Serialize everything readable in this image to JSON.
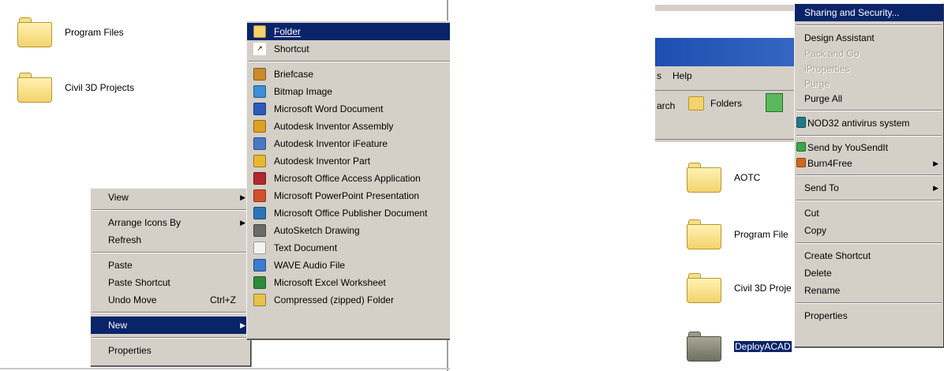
{
  "left": {
    "desktop_items": [
      "Program Files",
      "Civil 3D Projects"
    ],
    "context_menu": {
      "view": "View",
      "arrange": "Arrange Icons By",
      "refresh": "Refresh",
      "paste": "Paste",
      "paste_shortcut": "Paste Shortcut",
      "undo_move": "Undo Move",
      "undo_shortcut": "Ctrl+Z",
      "new": "New",
      "properties": "Properties"
    },
    "new_submenu": {
      "folder": "Folder",
      "shortcut": "Shortcut",
      "items": [
        {
          "label": "Briefcase",
          "icon": "briefcase-icon",
          "color": "#c98b2b"
        },
        {
          "label": "Bitmap Image",
          "icon": "bitmap-icon",
          "color": "#3a8fd6"
        },
        {
          "label": "Microsoft Word Document",
          "icon": "word-icon",
          "color": "#2b5cb8"
        },
        {
          "label": "Autodesk Inventor Assembly",
          "icon": "inventor-assembly-icon",
          "color": "#e0a020"
        },
        {
          "label": "Autodesk Inventor iFeature",
          "icon": "inventor-ifeature-icon",
          "color": "#4a78c4"
        },
        {
          "label": "Autodesk Inventor Part",
          "icon": "inventor-part-icon",
          "color": "#e8b830"
        },
        {
          "label": "Microsoft Office Access Application",
          "icon": "access-icon",
          "color": "#b3282d"
        },
        {
          "label": "Microsoft PowerPoint Presentation",
          "icon": "powerpoint-icon",
          "color": "#d2502a"
        },
        {
          "label": "Microsoft Office Publisher Document",
          "icon": "publisher-icon",
          "color": "#2c74b8"
        },
        {
          "label": "AutoSketch Drawing",
          "icon": "autosketch-icon",
          "color": "#6a6a6a"
        },
        {
          "label": "Text Document",
          "icon": "text-document-icon",
          "color": "#f4f4f4"
        },
        {
          "label": "WAVE Audio File",
          "icon": "wave-audio-icon",
          "color": "#3b7bd0"
        },
        {
          "label": "Microsoft Excel Worksheet",
          "icon": "excel-icon",
          "color": "#2f8a3a"
        },
        {
          "label": "Compressed (zipped) Folder",
          "icon": "zip-folder-icon",
          "color": "#e6c34a"
        }
      ]
    }
  },
  "right": {
    "explorer": {
      "menu_help": "Help",
      "menu_prefix": "s",
      "search_partial": "arch",
      "folders_button": "Folders",
      "items": [
        "AOTC",
        "Program File",
        "Civil 3D Proje",
        "DeployACAD"
      ]
    },
    "context_menu": {
      "sharing": "Sharing and Security...",
      "design_assistant": "Design Assistant",
      "pack_and_go": "Pack and Go",
      "iproperties": "iProperties",
      "purge": "Purge",
      "purge_all": "Purge All",
      "nod32": "NOD32 antivirus system",
      "yousendit": "Send by YouSendIt",
      "burn4free": "Burn4Free",
      "send_to": "Send To",
      "cut": "Cut",
      "copy": "Copy",
      "create_shortcut": "Create Shortcut",
      "delete": "Delete",
      "rename": "Rename",
      "properties": "Properties"
    }
  },
  "colors": {
    "menu_bg": "#d4d0c8",
    "highlight": "#0a246a",
    "explorer_blue": "#1c4fb0"
  }
}
